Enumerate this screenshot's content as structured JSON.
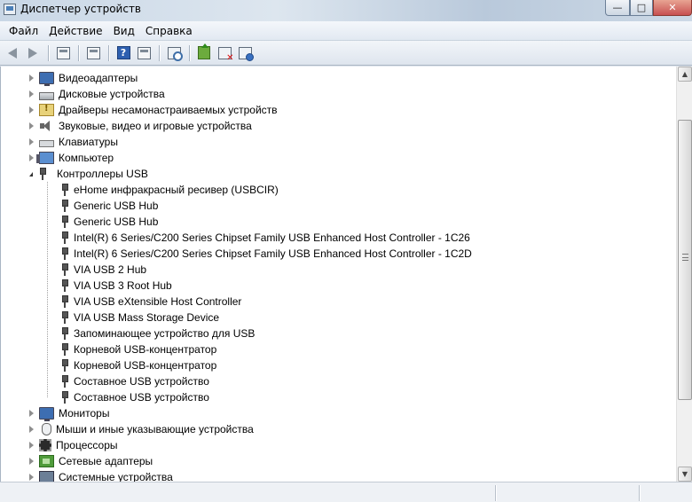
{
  "window": {
    "title": "Диспетчер устройств",
    "buttons": {
      "minimize": "—",
      "maximize": "□",
      "close": "✕"
    }
  },
  "menu": [
    "Файл",
    "Действие",
    "Вид",
    "Справка"
  ],
  "toolbar": [
    {
      "name": "back-arrow-icon",
      "kind": "arrow-left"
    },
    {
      "name": "forward-arrow-icon",
      "kind": "arrow-right"
    },
    {
      "name": "console-tree-icon",
      "kind": "sq"
    },
    {
      "name": "properties-icon",
      "kind": "sq"
    },
    {
      "name": "help-icon",
      "kind": "help"
    },
    {
      "name": "view-icon",
      "kind": "sq"
    },
    {
      "name": "scan-hardware-icon",
      "kind": "scan"
    },
    {
      "name": "update-driver-icon",
      "kind": "update"
    },
    {
      "name": "disable-device-icon",
      "kind": "disable"
    },
    {
      "name": "uninstall-device-icon",
      "kind": "uninstall"
    }
  ],
  "tree": [
    {
      "level": 0,
      "label": "Видеоадаптеры",
      "icon": "monitor",
      "state": "closed"
    },
    {
      "level": 0,
      "label": "Дисковые устройства",
      "icon": "disk",
      "state": "closed"
    },
    {
      "level": 0,
      "label": "Драйверы несамонастраиваемых устройств",
      "icon": "driver",
      "state": "closed"
    },
    {
      "level": 0,
      "label": "Звуковые, видео и игровые устройства",
      "icon": "sound",
      "state": "closed"
    },
    {
      "level": 0,
      "label": "Клавиатуры",
      "icon": "keyboard",
      "state": "closed"
    },
    {
      "level": 0,
      "label": "Компьютер",
      "icon": "computer",
      "state": "closed"
    },
    {
      "level": 0,
      "label": "Контроллеры USB",
      "icon": "usb",
      "state": "open"
    },
    {
      "level": 1,
      "label": "eHome инфракрасный ресивер (USBCIR)",
      "icon": "usb"
    },
    {
      "level": 1,
      "label": "Generic USB Hub",
      "icon": "usb"
    },
    {
      "level": 1,
      "label": "Generic USB Hub",
      "icon": "usb"
    },
    {
      "level": 1,
      "label": "Intel(R) 6 Series/C200 Series Chipset Family USB Enhanced Host Controller - 1C26",
      "icon": "usb"
    },
    {
      "level": 1,
      "label": "Intel(R) 6 Series/C200 Series Chipset Family USB Enhanced Host Controller - 1C2D",
      "icon": "usb"
    },
    {
      "level": 1,
      "label": "VIA USB 2 Hub",
      "icon": "usb"
    },
    {
      "level": 1,
      "label": "VIA USB 3 Root Hub",
      "icon": "usb"
    },
    {
      "level": 1,
      "label": "VIA USB eXtensible Host Controller",
      "icon": "usb"
    },
    {
      "level": 1,
      "label": "VIA USB Mass Storage Device",
      "icon": "usb"
    },
    {
      "level": 1,
      "label": "Запоминающее устройство для USB",
      "icon": "usb"
    },
    {
      "level": 1,
      "label": "Корневой USB-концентратор",
      "icon": "usb"
    },
    {
      "level": 1,
      "label": "Корневой USB-концентратор",
      "icon": "usb"
    },
    {
      "level": 1,
      "label": "Составное USB устройство",
      "icon": "usb"
    },
    {
      "level": 1,
      "label": "Составное USB устройство",
      "icon": "usb"
    },
    {
      "level": 0,
      "label": "Мониторы",
      "icon": "monitor",
      "state": "closed"
    },
    {
      "level": 0,
      "label": "Мыши и иные указывающие устройства",
      "icon": "mouse",
      "state": "closed"
    },
    {
      "level": 0,
      "label": "Процессоры",
      "icon": "cpu",
      "state": "closed"
    },
    {
      "level": 0,
      "label": "Сетевые адаптеры",
      "icon": "network",
      "state": "closed"
    },
    {
      "level": 0,
      "label": "Системные устройства",
      "icon": "system",
      "state": "closed"
    }
  ]
}
